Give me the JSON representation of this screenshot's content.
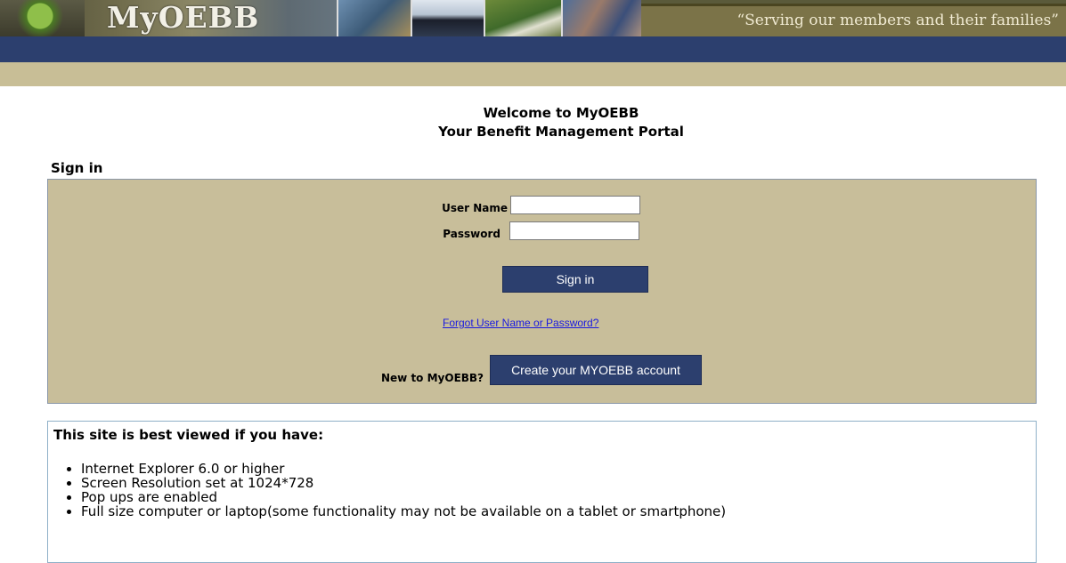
{
  "banner": {
    "logo_text": "MyOEBB",
    "slogan": "“Serving our members and their families”"
  },
  "welcome": {
    "line1": "Welcome to MyOEBB",
    "line2": "Your Benefit Management Portal"
  },
  "signin": {
    "heading": "Sign in",
    "username_label": "User Name",
    "username_value": "",
    "password_label": "Password",
    "password_value": "",
    "signin_button": "Sign in",
    "forgot_link": "Forgot User Name or Password?",
    "new_label": "New to MyOEBB?",
    "create_button": "Create your MYOEBB account"
  },
  "info": {
    "title": "This site is best viewed if you have:",
    "items": [
      "Internet Explorer 6.0 or higher",
      "Screen Resolution set at 1024*728",
      "Pop ups are enabled",
      "Full size computer or laptop(some functionality may not be available on a tablet or smartphone)"
    ]
  },
  "colors": {
    "nav_blue": "#2c3f6e",
    "tan": "#c8be96",
    "link_blue": "#1a1ae0"
  }
}
